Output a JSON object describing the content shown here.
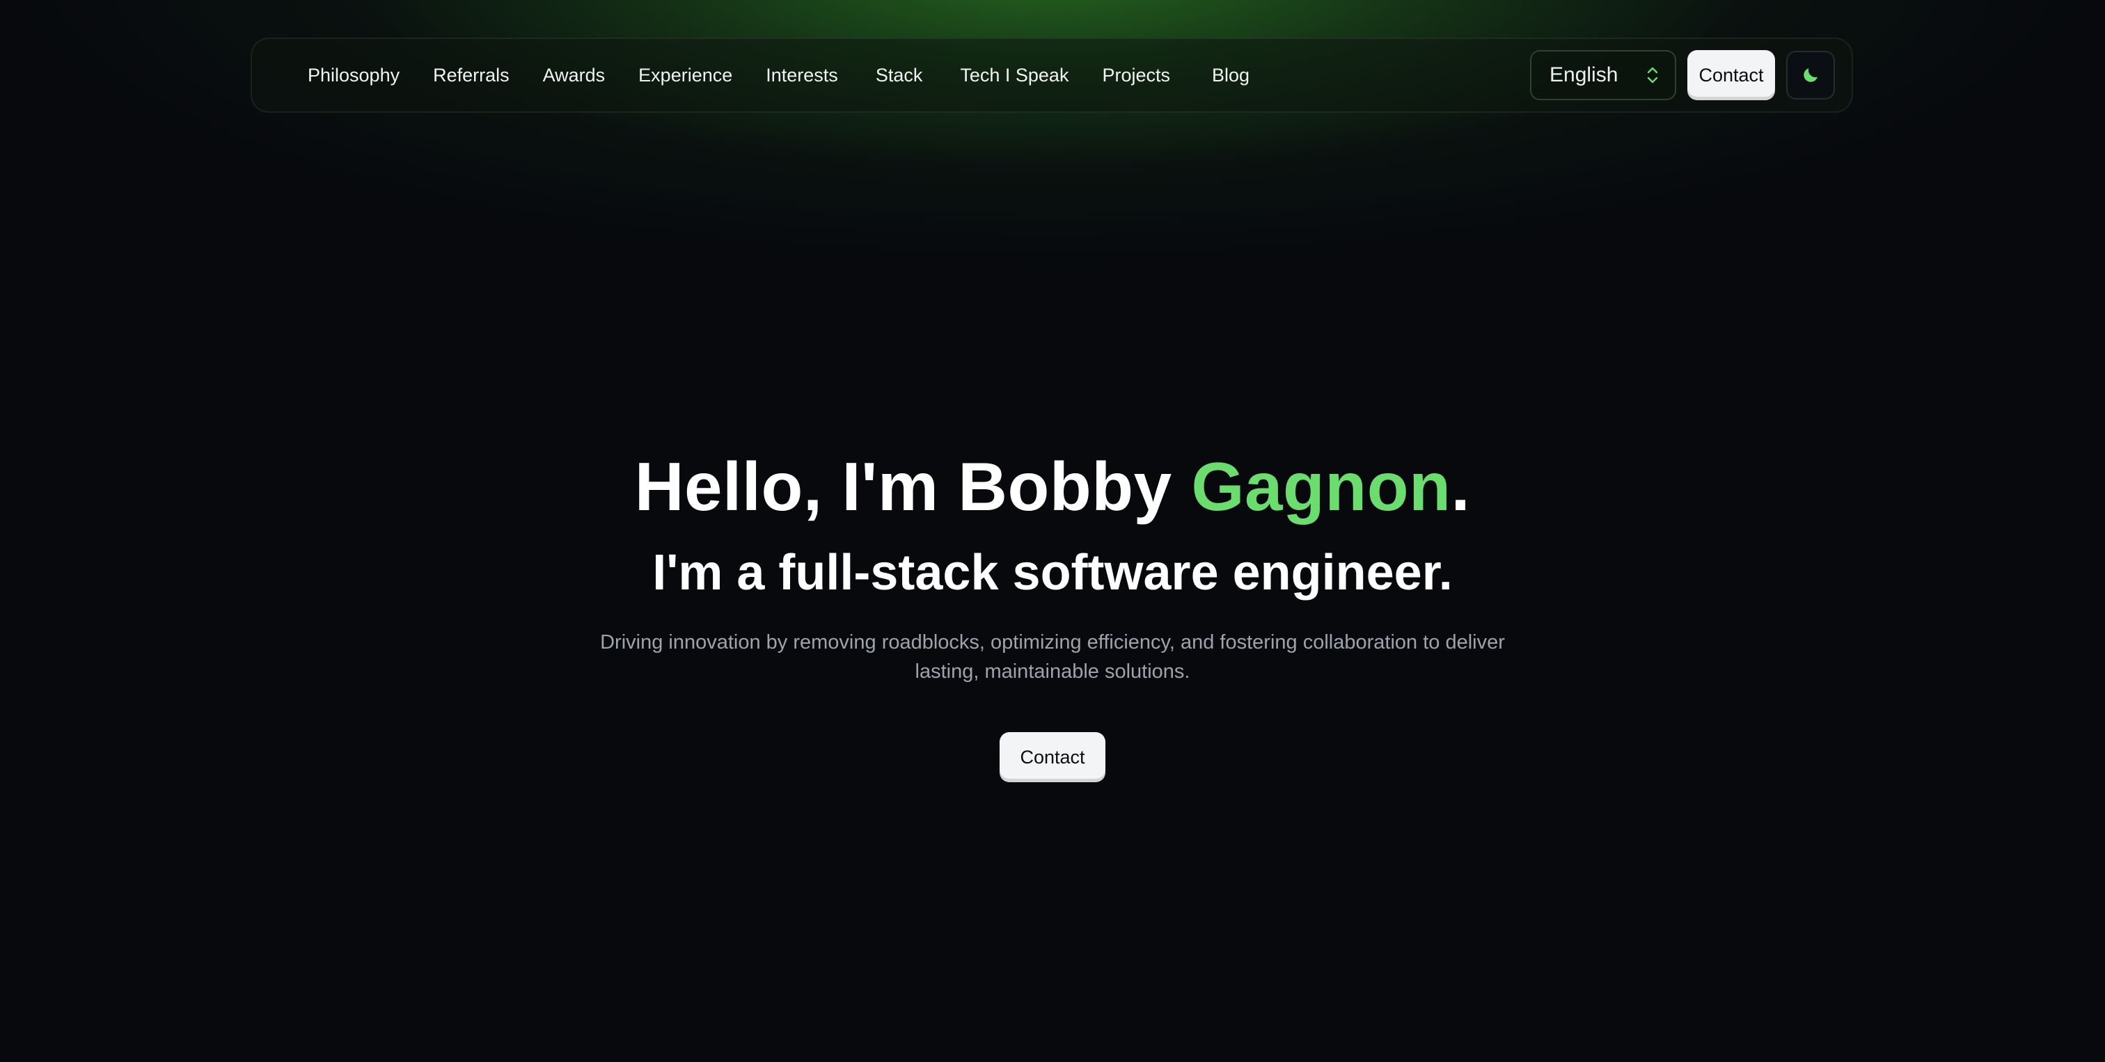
{
  "nav": {
    "links": [
      {
        "label": "Philosophy"
      },
      {
        "label": "Referrals"
      },
      {
        "label": "Awards"
      },
      {
        "label": "Experience"
      },
      {
        "label": "Interests"
      },
      {
        "label": "Stack"
      },
      {
        "label": "Tech I Speak"
      },
      {
        "label": "Projects"
      },
      {
        "label": "Blog"
      }
    ],
    "language": {
      "selected": "English",
      "icon": "chevron-up-down-icon"
    },
    "contact_label": "Contact",
    "theme_toggle_icon": "moon-icon"
  },
  "hero": {
    "title_prefix": "Hello, I'm Bobby ",
    "title_highlight": "Gagnon",
    "title_suffix": ".",
    "subtitle": "I'm a full-stack software engineer.",
    "description": "Driving innovation by removing roadblocks, optimizing efficiency, and fostering collaboration to deliver lasting, maintainable solutions.",
    "contact_label": "Contact"
  },
  "colors": {
    "accent": "#6bdc6e",
    "background": "#07090d",
    "header_glow": "#266820",
    "button_light": "#f3f4f6"
  }
}
